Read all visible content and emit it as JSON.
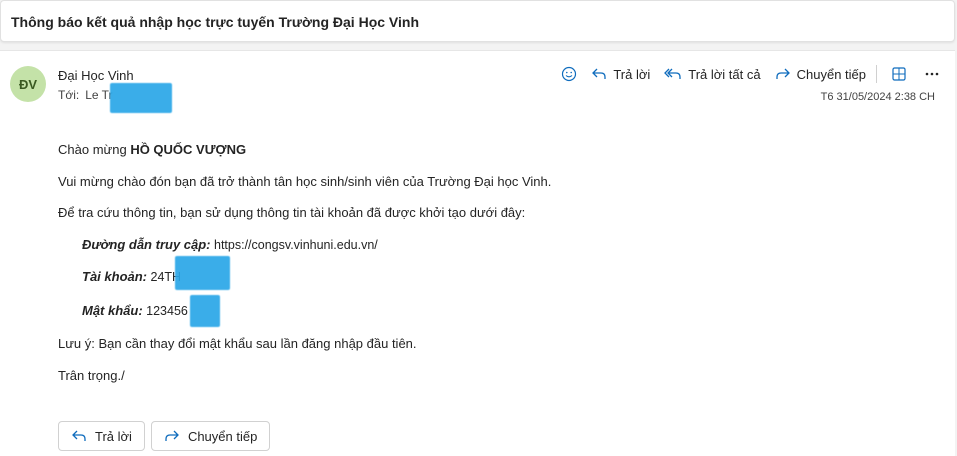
{
  "subject": "Thông báo kết quả nhập học trực tuyến Trường Đại Học Vinh",
  "header": {
    "avatar_initials": "ĐV",
    "sender": "Đại Học Vinh",
    "to_label": "Tới:",
    "to_value": "Le Tr",
    "timestamp": "T6 31/05/2024 2:38 CH"
  },
  "toolbar": {
    "reply": "Trả lời",
    "reply_all": "Trả lời tất cả",
    "forward": "Chuyển tiếp"
  },
  "body": {
    "greeting": "Chào mừng",
    "greeting_name": "HỒ QUỐC VƯỢNG",
    "welcome": "Vui mừng chào đón bạn đã trở thành tân học sinh/sinh viên của Trường Đại học Vinh.",
    "lookup": "Để tra cứu thông tin, bạn sử dụng thông tin tài khoản đã được khởi tạo dưới đây:",
    "url_label": "Đường dẫn truy cập:",
    "url_value": "https://congsv.vinhuni.edu.vn/",
    "account_label": "Tài khoản:",
    "account_value": "24TH",
    "password_label": "Mật khẩu:",
    "password_value": "123456",
    "note": "Lưu ý: Bạn cần thay đổi mật khẩu sau lần đăng nhập đầu tiên.",
    "closing": "Trân trọng./"
  },
  "reply_buttons": {
    "reply": "Trả lời",
    "forward": "Chuyển tiếp"
  },
  "colors": {
    "redaction": "#2aa7e8",
    "avatar_bg": "#c4e2a8",
    "icon_blue": "#0f6cbd"
  }
}
